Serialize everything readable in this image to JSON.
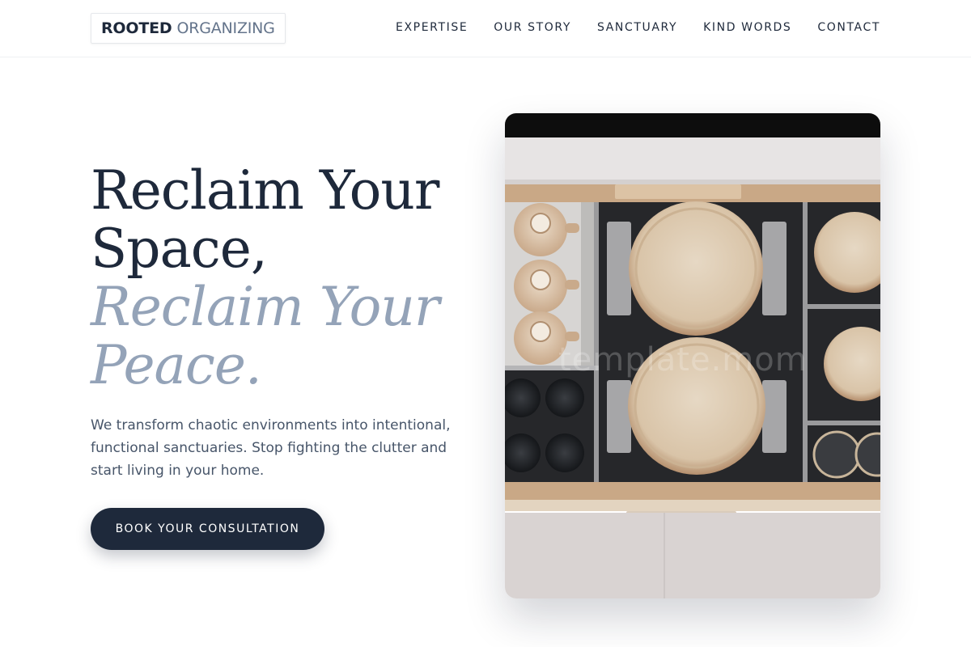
{
  "brand": {
    "name_strong": "ROOTED",
    "name_light": "ORGANIZING"
  },
  "nav": {
    "items": [
      {
        "label": "EXPERTISE"
      },
      {
        "label": "OUR STORY"
      },
      {
        "label": "SANCTUARY"
      },
      {
        "label": "KIND WORDS"
      },
      {
        "label": "CONTACT"
      }
    ]
  },
  "hero": {
    "title_line1": "Reclaim Your",
    "title_line2": "Space,",
    "title_line3": "Reclaim Your",
    "title_line4": "Peace.",
    "subtitle": "We transform chaotic environments into intentional, functional sanctuaries. Stop fighting the clutter and start living in your home.",
    "cta_label": "BOOK YOUR CONSULTATION"
  },
  "image": {
    "watermark": "template.mom"
  },
  "colors": {
    "primary": "#1e293b",
    "accent": "#94a3b8",
    "body_text": "#475569"
  }
}
